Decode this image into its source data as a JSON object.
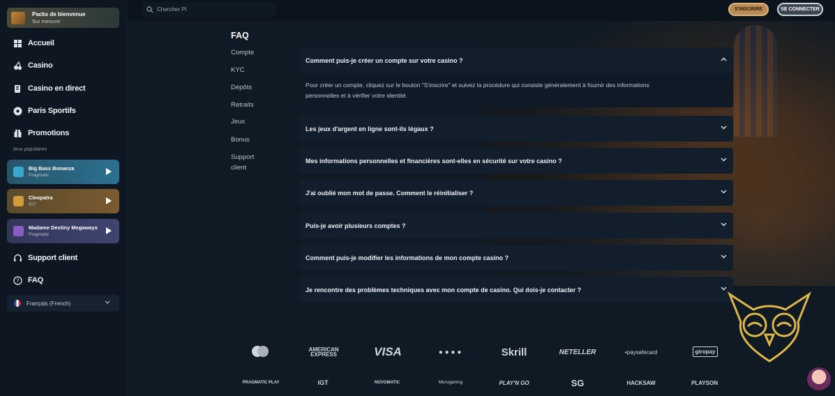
{
  "promo": {
    "title": "Packs de bienvenue",
    "subtitle": "Sur mesure!"
  },
  "nav": {
    "accueil": "Accueil",
    "casino": "Casino",
    "casino_direct": "Casino en direct",
    "paris": "Paris Sportifs",
    "promotions": "Promotions",
    "popular_label": "Jeux populaires",
    "support": "Support client",
    "faq": "FAQ"
  },
  "games": [
    {
      "title": "Big Bass Bonanza",
      "provider": "Pragmatic",
      "color": "#2a6a82"
    },
    {
      "title": "Cleopatra",
      "provider": "IGT",
      "color": "#6a5632"
    },
    {
      "title": "Madame Destiny Megaways",
      "provider": "Pragmatic",
      "color": "#3a3f62"
    }
  ],
  "language": "Français (French)",
  "topbar": {
    "search_placeholder": "Chercher Pl",
    "signup": "S'INSCRIRE",
    "login": "SE CONNECTER"
  },
  "faq": {
    "title": "FAQ",
    "categories": [
      "Compte",
      "KYC",
      "Dépôts",
      "Retraits",
      "Jeux",
      "Bonus",
      "Support client"
    ],
    "questions": [
      "Comment puis-je créer un compte sur votre casino ?",
      "Les jeux d'argent en ligne sont-ils légaux ?",
      "Mes informations personnelles et financières sont-elles en sécurité sur votre casino ?",
      "J'ai oublié mon mot de passe. Comment le réinitialiser ?",
      "Puis-je avoir plusieurs comptes ?",
      "Comment puis-je modifier les informations de mon compte casino ?",
      "Je rencontre des problèmes techniques avec mon compte de casino. Qui dois-je contacter ?"
    ],
    "answer_line1": "Pour créer un compte, cliquez sur le bouton \"S'inscrire\" et suivez la procédure qui consiste généralement à fournir des informations",
    "answer_line2": "personnelles et à vérifier votre identité."
  },
  "payments": [
    "mastercard",
    "AMERICAN EXPRESS",
    "VISA",
    "● ● ● ●",
    "Skrill",
    "NETELLER",
    "▪paysafecard",
    "giropay"
  ],
  "providers": [
    "PRAGMATIC PLAY",
    "IGT",
    "NOVOMATIC",
    "Microgaming",
    "PLAY'N GO",
    "SG",
    "HACKSAW",
    "PLAYSON"
  ],
  "colors": {
    "accent_gold": "#b98a53",
    "bg": "#0f1a24",
    "panel": "#121e2b"
  }
}
